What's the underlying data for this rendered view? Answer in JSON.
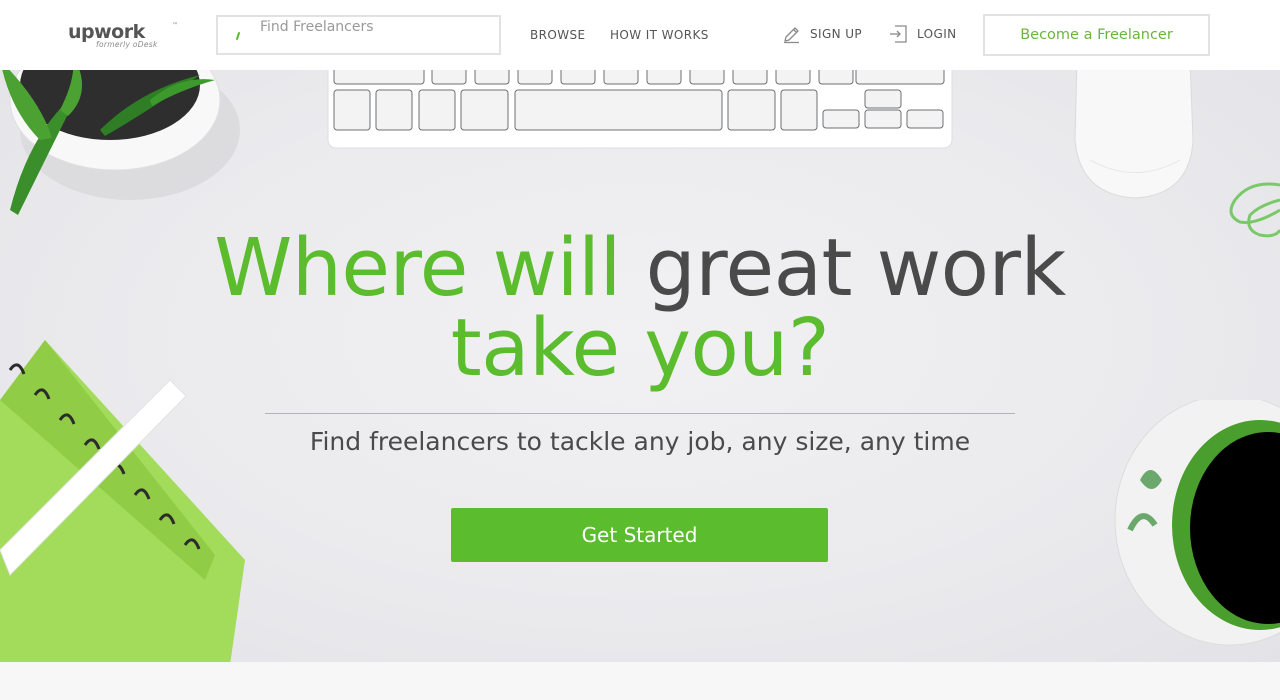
{
  "header": {
    "logo": {
      "word": "upwork",
      "tm": "™",
      "subtitle": "formerly oDesk"
    },
    "search": {
      "placeholder": "Find Freelancers",
      "value": ""
    },
    "nav": {
      "browse": "BROWSE",
      "how_it_works": "HOW IT WORKS",
      "sign_up": "SIGN UP",
      "login": "LOGIN"
    },
    "become_freelancer": "Become a Freelancer"
  },
  "hero": {
    "headline_green_1": "Where will",
    "headline_dark": "great work",
    "headline_green_2": "take you?",
    "subline": "Find freelancers to tackle any job, any size, any time",
    "cta": "Get Started"
  },
  "icons": {
    "search": "search-icon",
    "signup": "pencil-icon",
    "login": "login-arrow-icon"
  },
  "colors": {
    "brand_green": "#5bbc2e",
    "accent_green_text": "#6db33f",
    "heading_dark": "#4a4a4a"
  }
}
